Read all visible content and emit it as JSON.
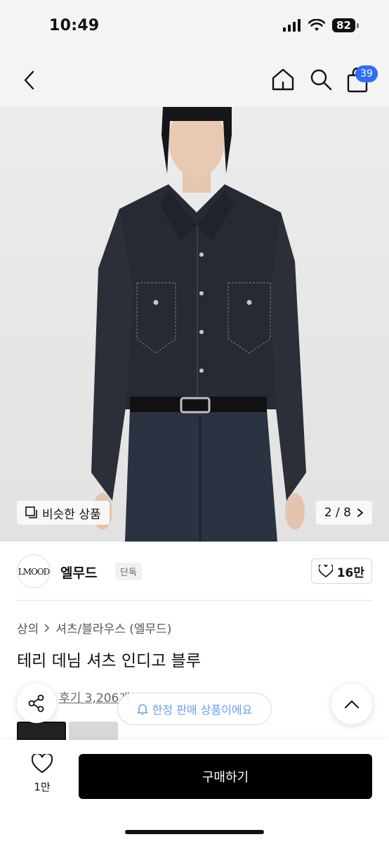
{
  "status": {
    "time": "10:49",
    "battery": "82"
  },
  "nav": {
    "cart_count": "39"
  },
  "hero": {
    "similar_label": "비슷한 상품",
    "page_indicator": "2 / 8"
  },
  "brand": {
    "logo_text": "LMOOD",
    "name": "엘무드",
    "tag": "단독",
    "likes": "16만"
  },
  "breadcrumb": {
    "level1": "상의",
    "level2": "셔츠/블라우스 (엘무드)"
  },
  "product": {
    "title": "테리 데님 셔츠 인디고 블루",
    "reviews": "후기 3,206개"
  },
  "floating": {
    "limited_label": "한정 판매 상품이에요"
  },
  "bottom": {
    "wish_count": "1만",
    "buy_label": "구매하기"
  },
  "colors": {
    "accent": "#2f6df6",
    "buy": "#000000",
    "limited": "#6a9cf5"
  }
}
